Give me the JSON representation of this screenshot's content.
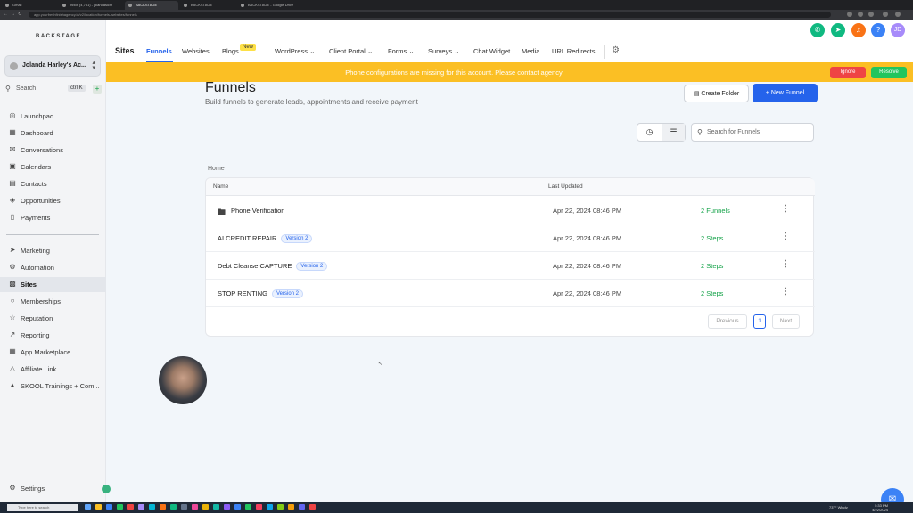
{
  "browser": {
    "tabs": [
      {
        "label": "Gmail"
      },
      {
        "label": "Inbox (4,751) - jolandaslcm"
      },
      {
        "label": "BACKSTAGE"
      },
      {
        "label": "BACKSTAGE"
      },
      {
        "label": "BACKSTAGE - Google Drive"
      }
    ],
    "url": "app.yourfreshfinishagency.io/v2/location/funnels-websites/funnels"
  },
  "sidebar": {
    "brand": "BACKSTAGE",
    "account_name": "Jolanda Harley's Ac...",
    "search_label": "Search",
    "search_kbd": "ctrl K",
    "items": [
      {
        "label": "Launchpad",
        "icon": "launchpad-icon"
      },
      {
        "label": "Dashboard",
        "icon": "dashboard-icon"
      },
      {
        "label": "Conversations",
        "icon": "chat-icon"
      },
      {
        "label": "Calendars",
        "icon": "calendar-icon"
      },
      {
        "label": "Contacts",
        "icon": "contacts-icon"
      },
      {
        "label": "Opportunities",
        "icon": "opportunities-icon"
      },
      {
        "label": "Payments",
        "icon": "payments-icon"
      },
      {
        "label": "Marketing",
        "icon": "marketing-icon"
      },
      {
        "label": "Automation",
        "icon": "automation-icon"
      },
      {
        "label": "Sites",
        "icon": "sites-icon",
        "active": true
      },
      {
        "label": "Memberships",
        "icon": "memberships-icon"
      },
      {
        "label": "Reputation",
        "icon": "reputation-icon"
      },
      {
        "label": "Reporting",
        "icon": "reporting-icon"
      },
      {
        "label": "App Marketplace",
        "icon": "marketplace-icon"
      },
      {
        "label": "Affiliate Link",
        "icon": "affiliate-icon"
      },
      {
        "label": "SKOOL Trainings + Com...",
        "icon": "school-icon"
      }
    ],
    "settings_label": "Settings"
  },
  "topnav": {
    "title": "Sites",
    "items": [
      "Funnels",
      "Websites",
      "Blogs",
      "WordPress",
      "Client Portal",
      "Forms",
      "Surveys",
      "Chat Widget",
      "Media",
      "URL Redirects"
    ],
    "new_badge": "New"
  },
  "header_icons": {
    "phone_color": "#10b981",
    "megaphone_color": "#10b981",
    "bell_color": "#f97316",
    "help_color": "#3b82f6",
    "user_initials": "JD",
    "user_color": "#a78bfa"
  },
  "banner": {
    "message": "Phone configurations are missing for this account. Please contact agency",
    "ignore_label": "Ignore",
    "resolve_label": "Resolve",
    "color": "#fbbf24"
  },
  "page": {
    "title": "Funnels",
    "subtitle": "Build funnels to generate leads, appointments and receive payment",
    "create_folder_label": "Create Folder",
    "new_funnel_label": "New Funnel",
    "search_placeholder": "Search for Funnels",
    "breadcrumb": "Home",
    "columns": {
      "name": "Name",
      "updated": "Last Updated"
    },
    "rows": [
      {
        "name": "Phone Verification",
        "badge": "",
        "updated": "Apr 22, 2024 08:46 PM",
        "count": "2 Funnels",
        "folder": true
      },
      {
        "name": "AI CREDIT REPAIR",
        "badge": "Version 2",
        "updated": "Apr 22, 2024 08:46 PM",
        "count": "2 Steps",
        "folder": false
      },
      {
        "name": "Debt Cleanse CAPTURE",
        "badge": "Version 2",
        "updated": "Apr 22, 2024 08:46 PM",
        "count": "2 Steps",
        "folder": false
      },
      {
        "name": "STOP RENTING",
        "badge": "Version 2",
        "updated": "Apr 22, 2024 08:46 PM",
        "count": "2 Steps",
        "folder": false
      }
    ],
    "pagination": {
      "previous": "Previous",
      "current": "1",
      "next": "Next"
    }
  },
  "taskbar": {
    "search_placeholder": "Type here to search",
    "weather": "73°F Windy",
    "time": "5:33 PM",
    "date": "4/22/2024"
  }
}
